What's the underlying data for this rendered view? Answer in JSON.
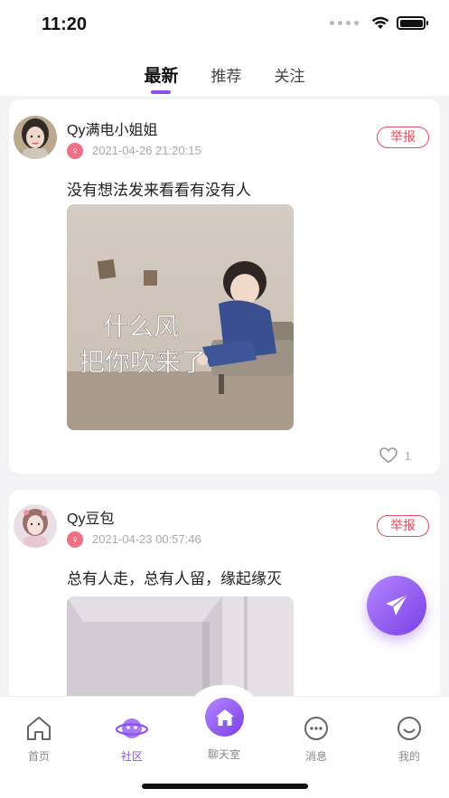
{
  "status_bar": {
    "time": "11:20",
    "wifi_icon": "wifi-icon",
    "battery_icon": "battery-icon"
  },
  "tabs": [
    {
      "label": "最新",
      "active": true
    },
    {
      "label": "推荐",
      "active": false
    },
    {
      "label": "关注",
      "active": false
    }
  ],
  "posts": [
    {
      "username": "Qy满电小姐姐",
      "gender_symbol": "♀",
      "timestamp": "2021-04-26 21:20:15",
      "report_label": "举报",
      "text": "没有想法发来看看有没有人",
      "image_caption_line1": "什么风",
      "image_caption_line2": "把你吹来了",
      "like_count": "1"
    },
    {
      "username": "Qy豆包",
      "gender_symbol": "♀",
      "timestamp": "2021-04-23 00:57:46",
      "report_label": "举报",
      "text": "总有人走，总有人留，缘起缘灭"
    }
  ],
  "fab": {
    "icon": "send-icon"
  },
  "bottom_nav": [
    {
      "label": "首页",
      "icon": "home-icon",
      "active": false
    },
    {
      "label": "社区",
      "icon": "planet-icon",
      "active": true
    },
    {
      "label": "聊天室",
      "icon": "house-filled-icon",
      "active": false
    },
    {
      "label": "消息",
      "icon": "chat-icon",
      "active": false
    },
    {
      "label": "我的",
      "icon": "smile-icon",
      "active": false
    }
  ],
  "colors": {
    "accent": "#8b4ff2",
    "report": "#e84a5f",
    "gender_female": "#f06f86"
  }
}
